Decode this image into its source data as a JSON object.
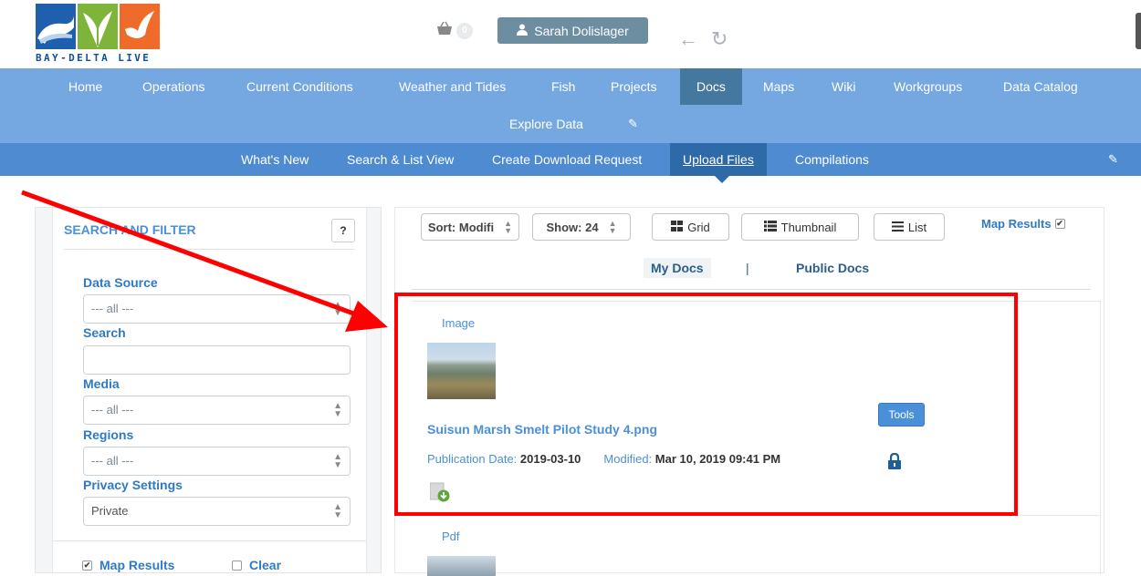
{
  "header": {
    "logo_text": "BAY-DELTA LIVE",
    "cart_count": "0",
    "user_name": "Sarah Dolislager"
  },
  "main_nav": {
    "items": [
      "Home",
      "Operations",
      "Current Conditions",
      "Weather and Tides",
      "Fish",
      "Projects",
      "Docs",
      "Maps",
      "Wiki",
      "Workgroups",
      "Data Catalog"
    ],
    "row2": "Explore Data",
    "active": "Docs"
  },
  "sub_nav": {
    "items": [
      "What's New",
      "Search & List View",
      "Create Download Request",
      "Upload Files",
      "Compilations"
    ],
    "active": "Upload Files"
  },
  "filter": {
    "title": "SEARCH AND FILTER",
    "help": "?",
    "data_source_label": "Data Source",
    "data_source_value": "--- all ---",
    "search_label": "Search",
    "media_label": "Media",
    "media_value": "--- all ---",
    "regions_label": "Regions",
    "regions_value": "--- all ---",
    "privacy_label": "Privacy Settings",
    "privacy_value": "Private",
    "map_results": "Map Results",
    "clear": "Clear"
  },
  "toolbar": {
    "sort": "Sort: Modifi",
    "show": "Show: 24",
    "grid": "Grid",
    "thumbnail": "Thumbnail",
    "list": "List",
    "map_results": "Map Results"
  },
  "doc_tabs": {
    "my_docs": "My Docs",
    "separator": "|",
    "public_docs": "Public Docs"
  },
  "docs": [
    {
      "type": "Image",
      "title": "Suisun Marsh Smelt Pilot Study 4.png",
      "pub_label": "Publication Date:",
      "pub_value": "2019-03-10",
      "mod_label": "Modified:",
      "mod_value": "Mar 10, 2019 09:41 PM",
      "tools": "Tools"
    },
    {
      "type": "Pdf"
    }
  ],
  "colors": {
    "nav": "#75a7e0",
    "subnav": "#4f8bd0",
    "active_tab": "#45789f",
    "link": "#4a90d9",
    "highlight": "#ff0000"
  }
}
